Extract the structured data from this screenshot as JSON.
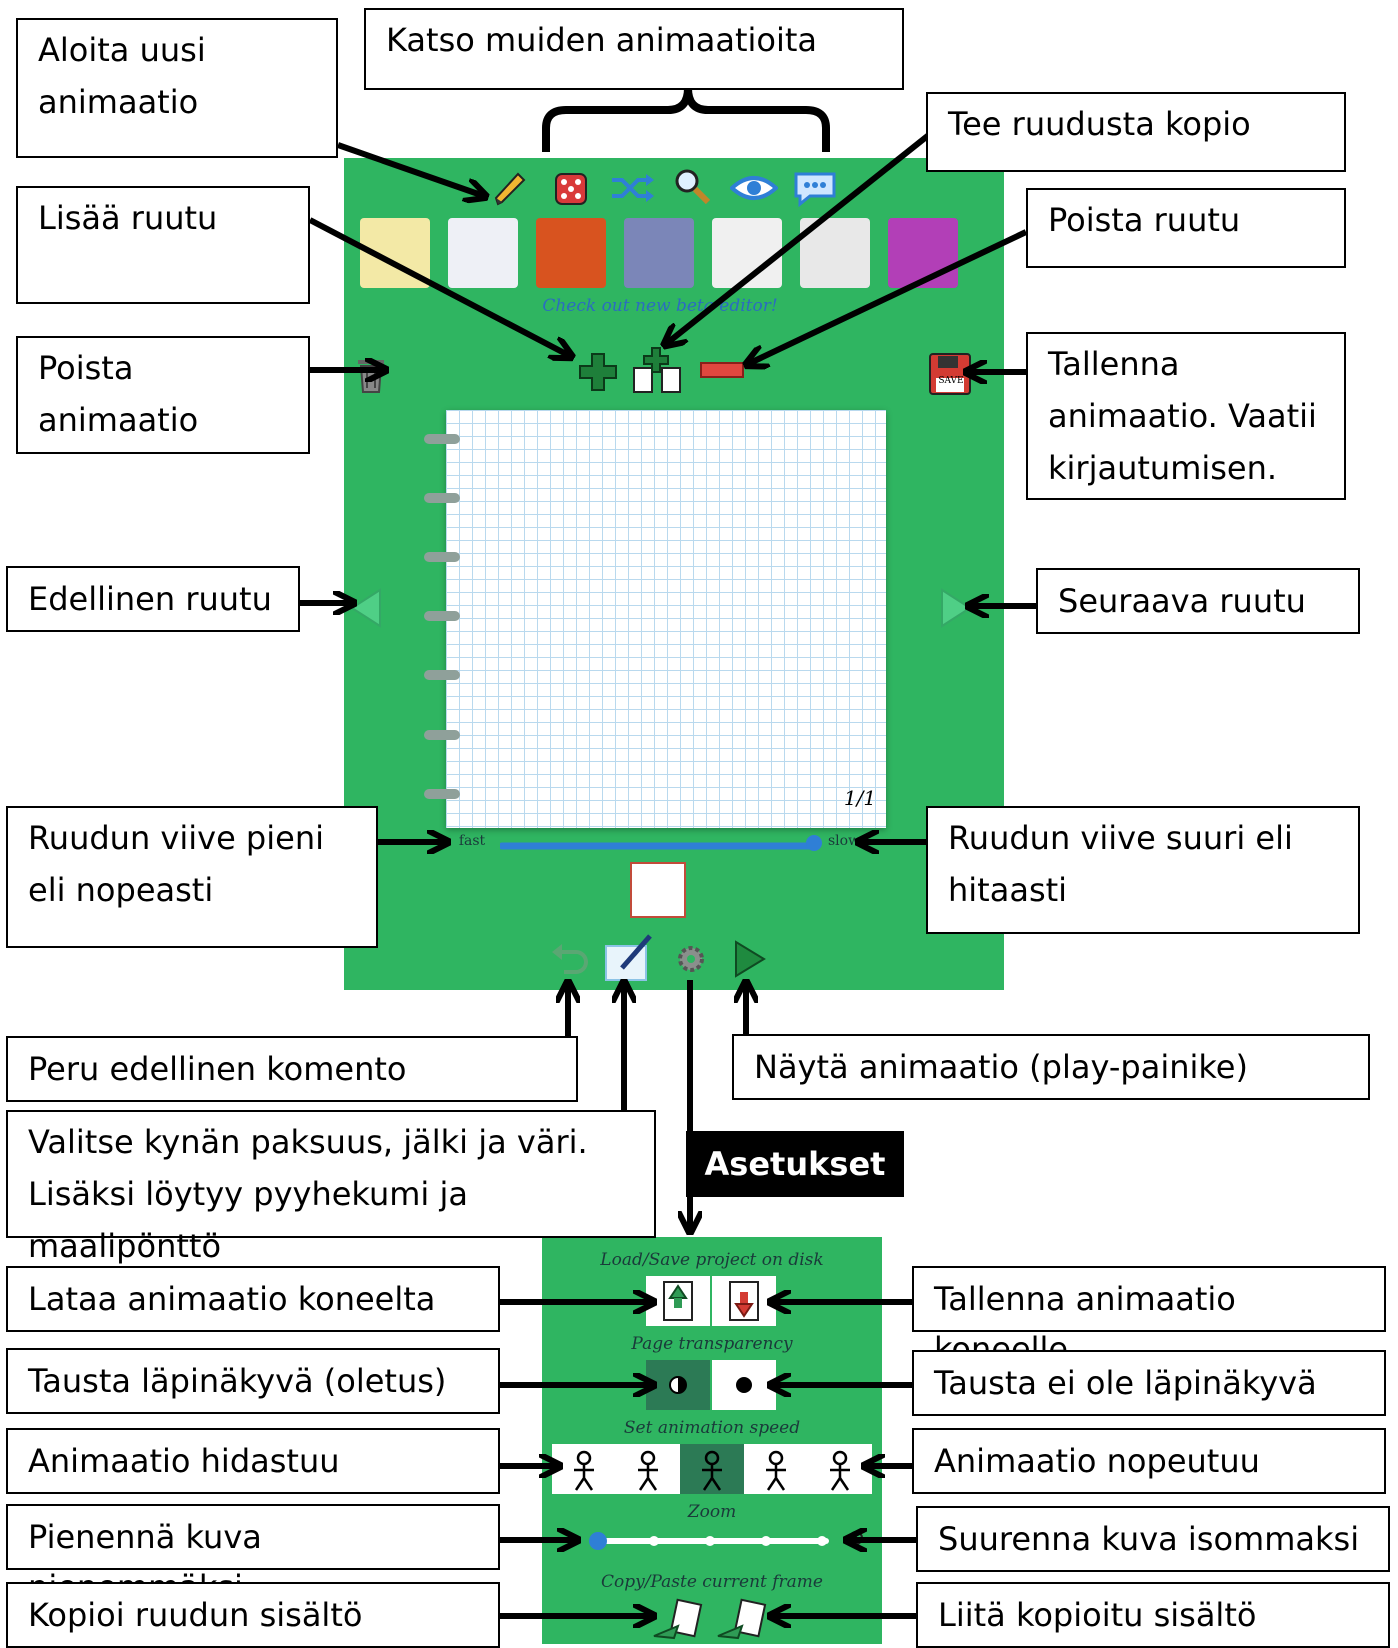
{
  "app": {
    "banner_link": "Check out new beta editor!",
    "frame_counter": "1/1",
    "speed_fast": "fast",
    "speed_slow": "slow",
    "save_badge": "SAVE"
  },
  "settings": {
    "load_save_title": "Load/Save project on disk",
    "transparency_title": "Page transparency",
    "speed_title": "Set animation speed",
    "zoom_title": "Zoom",
    "copy_paste_title": "Copy/Paste current frame"
  },
  "callouts": {
    "new_animation": "Aloita uusi animaatio",
    "browse_others": "Katso muiden animaatioita",
    "copy_frame": "Tee ruudusta kopio",
    "add_frame": "Lisää ruutu",
    "delete_frame": "Poista ruutu",
    "delete_animation": "Poista animaatio",
    "save_animation": "Tallenna animaatio. Vaatii kirjautumisen.",
    "previous_frame": "Edellinen ruutu",
    "next_frame": "Seuraava ruutu",
    "delay_small": "Ruudun viive pieni eli nopeasti",
    "delay_large": "Ruudun viive suuri eli hitaasti",
    "undo": "Peru edellinen komento",
    "play": "Näytä animaatio (play-painike)",
    "pen_options": "Valitse kynän paksuus, jälki ja väri. Lisäksi löytyy pyyhekumi ja maalipönttö",
    "settings_label": "Asetukset",
    "load_from_pc": "Lataa animaatio koneelta",
    "save_to_pc": "Tallenna animaatio koneelle",
    "bg_transparent": "Tausta läpinäkyvä (oletus)",
    "bg_opaque": "Tausta ei ole läpinäkyvä",
    "slower": "Animaatio hidastuu",
    "faster": "Animaatio nopeutuu",
    "zoom_out": "Pienennä kuva pienemmäksi",
    "zoom_in": "Suurenna kuva isommaksi",
    "copy_content": "Kopioi ruudun sisältö",
    "paste_content": "Liitä kopioitu sisältö"
  },
  "colors": {
    "app_green": "#2fb561",
    "accent_blue": "#2f7fd6",
    "delete_red": "#e0473f"
  },
  "speed_slider": {
    "value": 1.0
  },
  "zoom_slider": {
    "value": 0.0
  }
}
